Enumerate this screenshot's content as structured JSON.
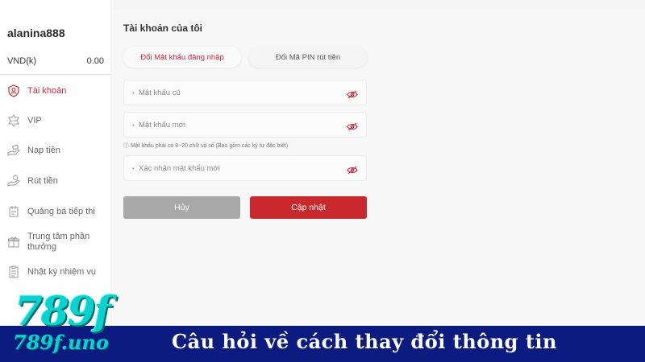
{
  "sidebar": {
    "username": "alanina888",
    "currency_label": "VND(k)",
    "balance": "0.00",
    "items": [
      {
        "label": "Tài khoản",
        "icon": "user-shield-icon"
      },
      {
        "label": "VIP",
        "icon": "vip-badge-icon"
      },
      {
        "label": "Nạp tiền",
        "icon": "deposit-hand-icon"
      },
      {
        "label": "Rút tiền",
        "icon": "withdraw-hand-icon"
      },
      {
        "label": "Quảng bá tiếp thị",
        "icon": "promotion-icon"
      },
      {
        "label": "Trung tâm phần thưởng",
        "icon": "gift-icon"
      },
      {
        "label": "Nhật ký nhiệm vụ",
        "icon": "task-log-icon"
      }
    ]
  },
  "main": {
    "title": "Tài khoản của tôi",
    "tabs": [
      {
        "label": "Đổi Mật khẩu đăng nhập",
        "active": true
      },
      {
        "label": "Đổi Mã PIN rút tiền",
        "active": false
      }
    ],
    "fields": {
      "old_password": {
        "placeholder": "Mật khẩu cũ",
        "value": ""
      },
      "new_password": {
        "placeholder": "Mật khẩu mới",
        "value": ""
      },
      "confirm_password": {
        "placeholder": "Xác nhận mật khẩu mới",
        "value": ""
      }
    },
    "hint": "Mật khẩu phải có 8~20 chữ và số (Bao gồm các ký tự đặc biệt)",
    "cancel_label": "Hủy",
    "update_label": "Cập nhật"
  },
  "banner": {
    "logo_big": "789f",
    "logo_small": "789f.uno",
    "title": "Câu hỏi về cách thay đổi thông tin"
  },
  "colors": {
    "accent": "#c8283a",
    "update_button": "#c9292d",
    "cancel_button": "#a8a8a8",
    "banner_bg": "#0c1b80",
    "logo": "#06d3cf"
  }
}
